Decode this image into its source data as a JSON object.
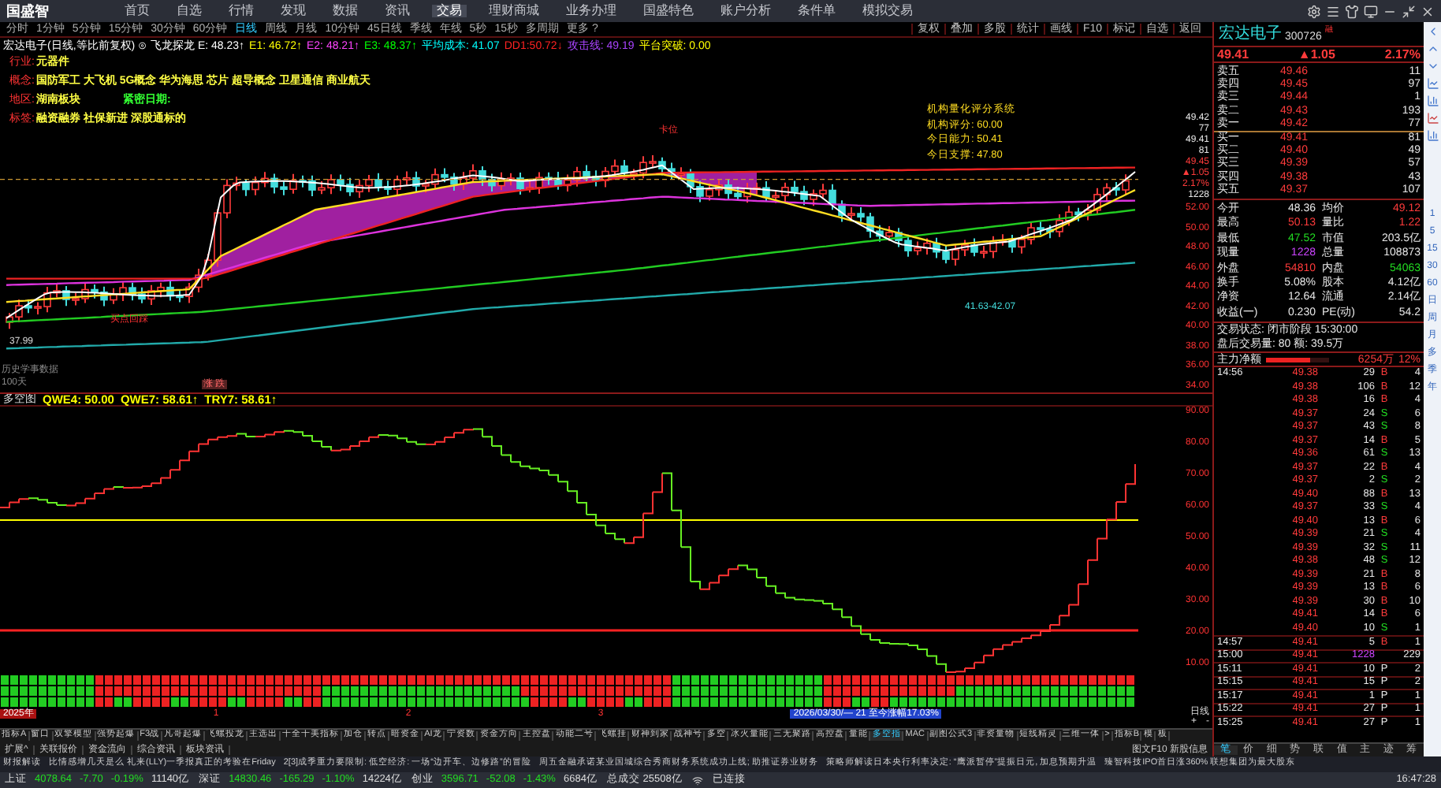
{
  "app": {
    "logo": "国盛智"
  },
  "menu": [
    {
      "label": "首页",
      "selected": false
    },
    {
      "label": "自选",
      "selected": false
    },
    {
      "label": "行情",
      "selected": false
    },
    {
      "label": "发现",
      "selected": false
    },
    {
      "label": "数据",
      "selected": false
    },
    {
      "label": "资讯",
      "selected": false
    },
    {
      "label": "交易",
      "selected": true
    },
    {
      "label": "理财商城",
      "selected": false
    },
    {
      "label": "业务办理",
      "selected": false
    },
    {
      "label": "国盛特色",
      "selected": false
    },
    {
      "label": "账户分析",
      "selected": false
    },
    {
      "label": "条件单",
      "selected": false
    },
    {
      "label": "模拟交易",
      "selected": false
    }
  ],
  "periods": [
    {
      "label": "分时",
      "selected": false
    },
    {
      "label": "1分钟",
      "selected": false
    },
    {
      "label": "5分钟",
      "selected": false
    },
    {
      "label": "15分钟",
      "selected": false
    },
    {
      "label": "30分钟",
      "selected": false
    },
    {
      "label": "60分钟",
      "selected": false
    },
    {
      "label": "日线",
      "selected": true
    },
    {
      "label": "周线",
      "selected": false
    },
    {
      "label": "月线",
      "selected": false
    },
    {
      "label": "10分钟",
      "selected": false
    },
    {
      "label": "45日线",
      "selected": false
    },
    {
      "label": "季线",
      "selected": false
    },
    {
      "label": "年线",
      "selected": false
    },
    {
      "label": "5秒",
      "selected": false
    },
    {
      "label": "15秒",
      "selected": false
    },
    {
      "label": "多周期",
      "selected": false
    },
    {
      "label": "更多 ?",
      "selected": false
    }
  ],
  "chart_toolbar": [
    "复权",
    "叠加",
    "多股",
    "统计",
    "画线",
    "F10",
    "标记",
    "自选",
    "返回"
  ],
  "legend": [
    {
      "text": "宏达电子(日线,等比前复权) ⊙ 飞龙探龙 E: 48.23↑",
      "color": "#ffffff"
    },
    {
      "text": "E1: 46.72↑",
      "color": "#ffff00"
    },
    {
      "text": "E2: 48.21↑",
      "color": "#ff44ff"
    },
    {
      "text": "E3: 48.37↑",
      "color": "#00ff00"
    },
    {
      "text": "平均成本: 41.07",
      "color": "#00ffff"
    },
    {
      "text": "DD1:50.72↓",
      "color": "#ff2222"
    },
    {
      "text": "攻击线: 49.19",
      "color": "#aa44ff"
    },
    {
      "text": "平台突破: 0.00",
      "color": "#ffff00"
    }
  ],
  "info": [
    {
      "label": "行业:",
      "value": "元器件"
    },
    {
      "label": "概念:",
      "value": "国防军工 大飞机 5G概念 华为海思 芯片 超导概念 卫星通信 商业航天"
    },
    {
      "label": "地区:",
      "value": "湖南板块",
      "extra": "紧密日期:"
    },
    {
      "label": "标签:",
      "value": "融资融券 社保新进 深股通标的"
    }
  ],
  "score_box": [
    "机构量化评分系统",
    "机构评分: 60.00",
    "今日能力: 50.41",
    "今日支撑: 47.80"
  ],
  "chart_marks": {
    "low": "37.99",
    "range": "41.63-42.07",
    "history": "历史学事数据",
    "days": "100天",
    "badge": "涨 跌",
    "buy_hint": "买点回踩",
    "top": "卡位"
  },
  "main_axis": {
    "top": [
      {
        "text": "49.42",
        "color": "#e8e8e8"
      },
      {
        "text": "77",
        "color": "#e8e8e8"
      },
      {
        "text": "49.41",
        "color": "#e8e8e8"
      },
      {
        "text": "81",
        "color": "#e8e8e8"
      },
      {
        "text": "49.45",
        "color": "#ff3b3b"
      },
      {
        "text": "▲1.05",
        "color": "#ff3b3b"
      },
      {
        "text": "2.17%",
        "color": "#ff3b3b"
      },
      {
        "text": "1228",
        "color": "#e8e8e8"
      }
    ],
    "ticks": [
      "52.00",
      "50.00",
      "48.00",
      "46.00",
      "44.00",
      "42.00",
      "40.00",
      "38.00",
      "36.00",
      "34.00"
    ]
  },
  "indicator": {
    "name": "多空图",
    "values": [
      {
        "text": "QWE4: 50.00",
        "color": "#ffff00"
      },
      {
        "text": "QWE7: 58.61↑",
        "color": "#ffff00"
      },
      {
        "text": "TRY7: 58.61↑",
        "color": "#ffff00"
      }
    ],
    "ticks": [
      "90.00",
      "80.00",
      "70.00",
      "60.00",
      "50.00",
      "40.00",
      "30.00",
      "20.00",
      "10.00"
    ],
    "period": "日线",
    "zoom": [
      "+",
      "-"
    ]
  },
  "timeline": {
    "year": "2025年",
    "months": [
      "1",
      "2",
      "3"
    ],
    "tooltip": "2026/03/30/— 21 至今涨幅17.03%"
  },
  "indicator_tabs": [
    {
      "label": "指标A",
      "selected": false
    },
    {
      "label": "窗口",
      "selected": false
    },
    {
      "label": "双擎模型",
      "selected": false
    },
    {
      "label": "强势起爆",
      "selected": false
    },
    {
      "label": "F3战",
      "selected": false
    },
    {
      "label": "凡哥起爆",
      "selected": false
    },
    {
      "label": "飞螺投龙",
      "selected": false
    },
    {
      "label": "主选出",
      "selected": false
    },
    {
      "label": "十全十美指标",
      "selected": false
    },
    {
      "label": "加仓",
      "selected": false
    },
    {
      "label": "转点",
      "selected": false
    },
    {
      "label": "暗资金",
      "selected": false
    },
    {
      "label": "AI龙",
      "selected": false
    },
    {
      "label": "宁资数",
      "selected": false
    },
    {
      "label": "资金方向",
      "selected": false
    },
    {
      "label": "主控盘",
      "selected": false
    },
    {
      "label": "动能二号",
      "selected": false
    },
    {
      "label": "飞螺挂",
      "selected": false
    },
    {
      "label": "财神到家",
      "selected": false
    },
    {
      "label": "战神号",
      "selected": false
    },
    {
      "label": "多空",
      "selected": false
    },
    {
      "label": "冰火量能",
      "selected": false
    },
    {
      "label": "三无聚路",
      "selected": false
    },
    {
      "label": "高控盘",
      "selected": false
    },
    {
      "label": "量能",
      "selected": false
    },
    {
      "label": "多空指",
      "selected": true
    },
    {
      "label": "MAC",
      "selected": false
    },
    {
      "label": "副图公式3",
      "selected": false
    },
    {
      "label": "非资量物",
      "selected": false
    },
    {
      "label": "短线精灵",
      "selected": false
    },
    {
      "label": "三维一体",
      "selected": false
    },
    {
      "label": ">",
      "selected": false
    },
    {
      "label": "指标B",
      "selected": false
    },
    {
      "label": "模",
      "selected": false
    },
    {
      "label": "板",
      "selected": false
    }
  ],
  "extra_tabs": [
    "扩展^",
    "关联报价",
    "资金流向",
    "综合资讯",
    "板块资讯"
  ],
  "extra_right": "图文F10 新股信息",
  "quote": {
    "name": "宏达电子",
    "code": "300726",
    "tag": "融",
    "price": "49.41",
    "change": "▲1.05",
    "percent": "2.17%"
  },
  "order_book": [
    {
      "label": "卖五",
      "price": "49.46",
      "volume": "11"
    },
    {
      "label": "卖四",
      "price": "49.45",
      "volume": "97"
    },
    {
      "label": "卖三",
      "price": "49.44",
      "volume": "1"
    },
    {
      "label": "卖二",
      "price": "49.43",
      "volume": "193"
    },
    {
      "label": "卖一",
      "price": "49.42",
      "volume": "77"
    },
    {
      "label": "买一",
      "price": "49.41",
      "volume": "81"
    },
    {
      "label": "买二",
      "price": "49.40",
      "volume": "49"
    },
    {
      "label": "买三",
      "price": "49.39",
      "volume": "57"
    },
    {
      "label": "买四",
      "price": "49.38",
      "volume": "43"
    },
    {
      "label": "买五",
      "price": "49.37",
      "volume": "107"
    }
  ],
  "stats": [
    {
      "label": "今开",
      "value": "48.36",
      "color": "#e8e8e8"
    },
    {
      "label": "均价",
      "value": "49.12",
      "color": "#ff3b3b"
    },
    {
      "label": "最高",
      "value": "50.13",
      "color": "#ff3b3b"
    },
    {
      "label": "量比",
      "value": "1.22",
      "color": "#ff3b3b"
    },
    {
      "label": "最低",
      "value": "47.52",
      "color": "#22dd22"
    },
    {
      "label": "市值",
      "value": "203.5亿",
      "color": "#e8e8e8"
    },
    {
      "label": "现量",
      "value": "1228",
      "color": "#cc44ff"
    },
    {
      "label": "总量",
      "value": "108873",
      "color": "#e8e8e8"
    },
    {
      "label": "外盘",
      "value": "54810",
      "color": "#ff3b3b"
    },
    {
      "label": "内盘",
      "value": "54063",
      "color": "#22dd22"
    },
    {
      "label": "换手",
      "value": "5.08%",
      "color": "#e8e8e8"
    },
    {
      "label": "股本",
      "value": "4.12亿",
      "color": "#e8e8e8"
    },
    {
      "label": "净资",
      "value": "12.64",
      "color": "#e8e8e8"
    },
    {
      "label": "流通",
      "value": "2.14亿",
      "color": "#e8e8e8"
    },
    {
      "label": "收益(一)",
      "value": "0.230",
      "color": "#e8e8e8"
    },
    {
      "label": "PE(动)",
      "value": "54.2",
      "color": "#e8e8e8"
    }
  ],
  "trade_status": [
    "交易状态: 闭市阶段 15:30:00",
    "盘后交易量: 80 额: 39.5万"
  ],
  "main_flow": {
    "label": "主力净额",
    "amount": "6254万",
    "percent": "12%",
    "level": 0.7
  },
  "trades": [
    {
      "time": "14:56",
      "price": "49.38",
      "volume": "29",
      "flag": "B",
      "kind": "buy",
      "count": "4",
      "highlight": false
    },
    {
      "price": "49.38",
      "volume": "106",
      "flag": "B",
      "kind": "buy",
      "count": "12",
      "highlight": false
    },
    {
      "price": "49.38",
      "volume": "16",
      "flag": "B",
      "kind": "buy",
      "count": "4",
      "highlight": false
    },
    {
      "price": "49.37",
      "volume": "24",
      "flag": "S",
      "kind": "sell",
      "count": "6",
      "highlight": false
    },
    {
      "price": "49.37",
      "volume": "43",
      "flag": "S",
      "kind": "sell",
      "count": "8",
      "highlight": false
    },
    {
      "price": "49.37",
      "volume": "14",
      "flag": "B",
      "kind": "buy",
      "count": "5",
      "highlight": false
    },
    {
      "price": "49.36",
      "volume": "61",
      "flag": "S",
      "kind": "sell",
      "count": "13",
      "highlight": false
    },
    {
      "price": "49.37",
      "volume": "22",
      "flag": "B",
      "kind": "buy",
      "count": "4",
      "highlight": false
    },
    {
      "price": "49.37",
      "volume": "2",
      "flag": "S",
      "kind": "sell",
      "count": "2",
      "highlight": false
    },
    {
      "price": "49.40",
      "volume": "88",
      "flag": "B",
      "kind": "buy",
      "count": "13",
      "highlight": false
    },
    {
      "price": "49.37",
      "volume": "33",
      "flag": "S",
      "kind": "sell",
      "count": "4",
      "highlight": false
    },
    {
      "price": "49.40",
      "volume": "13",
      "flag": "B",
      "kind": "buy",
      "count": "6",
      "highlight": false
    },
    {
      "price": "49.39",
      "volume": "21",
      "flag": "S",
      "kind": "sell",
      "count": "4",
      "highlight": false
    },
    {
      "price": "49.39",
      "volume": "32",
      "flag": "S",
      "kind": "sell",
      "count": "11",
      "highlight": false
    },
    {
      "price": "49.38",
      "volume": "48",
      "flag": "S",
      "kind": "sell",
      "count": "12",
      "highlight": false
    },
    {
      "price": "49.39",
      "volume": "21",
      "flag": "B",
      "kind": "buy",
      "count": "8",
      "highlight": false
    },
    {
      "price": "49.39",
      "volume": "13",
      "flag": "B",
      "kind": "buy",
      "count": "6",
      "highlight": false
    },
    {
      "price": "49.39",
      "volume": "30",
      "flag": "B",
      "kind": "buy",
      "count": "10",
      "highlight": false
    },
    {
      "price": "49.41",
      "volume": "14",
      "flag": "B",
      "kind": "buy",
      "count": "6",
      "highlight": false
    },
    {
      "price": "49.40",
      "volume": "10",
      "flag": "S",
      "kind": "sell",
      "count": "1",
      "highlight": false
    },
    {
      "time": "14:57",
      "price": "49.41",
      "volume": "5",
      "flag": "B",
      "kind": "buy",
      "count": "1",
      "highlight": false
    },
    {
      "time": "15:00",
      "price": "49.41",
      "volume": "1228",
      "kind": "none",
      "count": "229",
      "highlight": true
    },
    {
      "time": "15:11",
      "price": "49.41",
      "volume": "10",
      "flag": "P",
      "kind": "post",
      "count": "2",
      "highlight": false
    },
    {
      "time": "15:15",
      "price": "49.41",
      "volume": "15",
      "flag": "P",
      "kind": "post",
      "count": "2",
      "highlight": false
    },
    {
      "time": "15:17",
      "price": "49.41",
      "volume": "1",
      "flag": "P",
      "kind": "post",
      "count": "1",
      "highlight": false
    },
    {
      "time": "15:22",
      "price": "49.41",
      "volume": "27",
      "flag": "P",
      "kind": "post",
      "count": "1",
      "highlight": false
    },
    {
      "time": "15:25",
      "price": "49.41",
      "volume": "27",
      "flag": "P",
      "kind": "post",
      "count": "1",
      "highlight": false
    }
  ],
  "panel_tabs": [
    {
      "label": "笔",
      "selected": true
    },
    {
      "label": "价",
      "selected": false
    },
    {
      "label": "细",
      "selected": false
    },
    {
      "label": "势",
      "selected": false
    },
    {
      "label": "联",
      "selected": false
    },
    {
      "label": "值",
      "selected": false
    },
    {
      "label": "主",
      "selected": false
    },
    {
      "label": "迹",
      "selected": false
    },
    {
      "label": "筹",
      "selected": false
    }
  ],
  "side_periods": [
    "1",
    "5",
    "15",
    "30",
    "60",
    "日",
    "周",
    "月",
    "多",
    "季",
    "年"
  ],
  "ticker": [
    "财报解读",
    "比情感增几天是么 礼来(LLY)一季报真正的考验在Friday",
    "2[3]成季重力要限制: 低空经济: 一场“边开车、边修路”的冒险",
    "周五金融承诺某业国城综合秀商财务系统成功上线; 助推证券业财务",
    "策略师解读日本央行利率决定: “鹰派暂停”提振日元, 加息预期升温",
    "臻智科技IPO首日涨360% 联想集团为最大股东"
  ],
  "indices": [
    {
      "name": "上证",
      "value": "4078.64",
      "change": "-7.70",
      "percent": "-0.19%",
      "amount": "11140亿"
    },
    {
      "name": "深证",
      "value": "14830.46",
      "change": "-165.29",
      "percent": "-1.10%",
      "amount": "14224亿"
    },
    {
      "name": "创业",
      "value": "3596.71",
      "change": "-52.08",
      "percent": "-1.43%",
      "amount": "6684亿"
    }
  ],
  "total": "总成交 25508亿",
  "connection": "已连接",
  "clock": "16:47:28"
}
